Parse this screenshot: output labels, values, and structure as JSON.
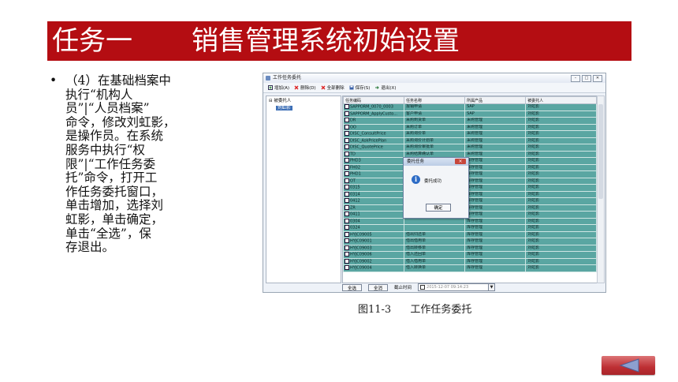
{
  "banner": {
    "part1": "任务一",
    "part2": "销售管理系统初始设置"
  },
  "body": {
    "bullet": "•",
    "text": "（4）在基础档案中\n执行“机构人\n员”|“人员档案”\n命令，修改刘虹影，\n是操作员。在系统\n服务中执行“权\n限”|“工作任务委\n托”命令，打开工\n作任务委托窗口，\n单击增加，选择刘\n虹影，单击确定，\n单击“全选”，保\n存退出。"
  },
  "window": {
    "title": "工作任务委托",
    "toolbar": {
      "add": "增加(A)",
      "delete": "删除(D)",
      "delete_all": "全部删除",
      "save": "保存(S)",
      "exit": "退出(X)"
    },
    "tree": {
      "root": "被委托人",
      "child": "刘虹影"
    },
    "columns": [
      "任务编码",
      "任务名称",
      "所属产品",
      "被委托人"
    ],
    "rows": [
      [
        "SAPPORM_0070_0003",
        "报销申请",
        "SAP",
        "刘虹影"
      ],
      [
        "SAPPORM_ApplyCusto...",
        "客户申请",
        "SAP",
        "刘虹影"
      ],
      [
        "DR",
        "采购到货单",
        "采购管理",
        "刘虹影"
      ],
      [
        "OO",
        "采购订单",
        "采购管理",
        "刘虹影"
      ],
      [
        "DISC_ConsultPrice",
        "采购询价单",
        "采购管理",
        "刘虹影"
      ],
      [
        "DISC_AskPricePlan",
        "采购询价计划单",
        "采购管理",
        "刘虹影"
      ],
      [
        "DISC_QuotePrice",
        "采购询价审批单",
        "采购管理",
        "刘虹影"
      ],
      [
        "TD",
        "采购结算确认单",
        "采购管理",
        "刘虹影"
      ],
      [
        "PHD3",
        "",
        "库存管理",
        "刘虹影"
      ],
      [
        "FH02",
        "",
        "库存管理",
        "刘虹影"
      ],
      [
        "PHD1",
        "",
        "库存管理",
        "刘虹影"
      ],
      [
        "OT",
        "",
        "库存管理",
        "刘虹影"
      ],
      [
        "0315",
        "",
        "库存管理",
        "刘虹影"
      ],
      [
        "0314",
        "",
        "库存管理",
        "刘虹影"
      ],
      [
        "0412",
        "",
        "库存管理",
        "刘虹影"
      ],
      [
        "ZR",
        "",
        "库存管理",
        "刘虹影"
      ],
      [
        "0411",
        "",
        "库存管理",
        "刘虹影"
      ],
      [
        "0304",
        "",
        "库存管理",
        "刘虹影"
      ],
      [
        "0324",
        "",
        "库存管理",
        "刘虹影"
      ],
      [
        "HYJC09005",
        "借出归还单",
        "库存管理",
        "刘虹影"
      ],
      [
        "HYJC09001",
        "借出借用单",
        "库存管理",
        "刘虹影"
      ],
      [
        "HYJC09003",
        "借出转移单",
        "库存管理",
        "刘虹影"
      ],
      [
        "HYJC09006",
        "借入还回单",
        "库存管理",
        "刘虹影"
      ],
      [
        "HYJC09002",
        "借入借用单",
        "库存管理",
        "刘虹影"
      ],
      [
        "HYJC09004",
        "借入转换单",
        "库存管理",
        "刘虹影"
      ]
    ],
    "bottom": {
      "select_all": "全选",
      "clear_all": "全消",
      "expire_label": "截止时间",
      "date_value": "2015-12-07 09:14:23"
    },
    "dialog": {
      "title": "委托任务",
      "message": "委托成功",
      "ok": "确定"
    }
  },
  "caption": {
    "fig": "图11-3",
    "text": "工作任务委托"
  }
}
